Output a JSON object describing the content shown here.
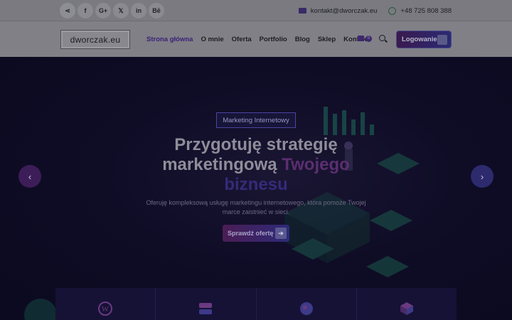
{
  "topbar": {
    "socials": [
      {
        "name": "share-icon",
        "glyph": "⋖"
      },
      {
        "name": "facebook-icon",
        "glyph": "f"
      },
      {
        "name": "google-plus-icon",
        "glyph": "G+"
      },
      {
        "name": "x-twitter-icon",
        "glyph": "𝕏"
      },
      {
        "name": "linkedin-icon",
        "glyph": "in"
      },
      {
        "name": "behance-icon",
        "glyph": "Bē"
      }
    ],
    "email": "kontakt@dworczak.eu",
    "phone": "+48 725 808 388"
  },
  "nav": {
    "logo": "dworczak.eu",
    "items": [
      {
        "label": "Strona główna",
        "active": true
      },
      {
        "label": "O mnie"
      },
      {
        "label": "Oferta"
      },
      {
        "label": "Portfolio"
      },
      {
        "label": "Blog"
      },
      {
        "label": "Sklep"
      },
      {
        "label": "Kontakt"
      }
    ],
    "cart_count": "0",
    "login_label": "Logowanie"
  },
  "hero": {
    "tag": "Marketing Internetowy",
    "title_line1": "Przygotuję strategię",
    "title_line2a": "marketingową ",
    "title_line2b": "Twojego",
    "title_line3": "biznesu",
    "subtitle": "Oferuję kompleksową usługę marketingu internetowego, która pomoże Twojej marce zaistnieć w sieci.",
    "cta_label": "Sprawdź ofertę"
  },
  "features": [
    {
      "icon": "wordpress-icon"
    },
    {
      "icon": "server-icon"
    },
    {
      "icon": "globe-icon"
    },
    {
      "icon": "box-icon"
    }
  ],
  "colors": {
    "accent_purple": "#5b2e70",
    "accent_blue": "#2d2a78",
    "hero_bg": "#0f0c26"
  }
}
